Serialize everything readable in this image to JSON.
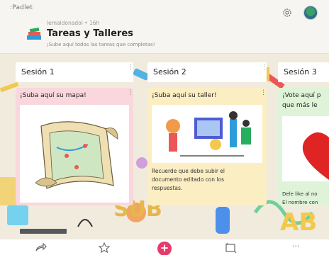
{
  "header": {
    "brand": ":Padlet",
    "meta": "lemaldonadol • 16h",
    "title": "Tareas y Talleres",
    "chevron": "›",
    "description": "¡Sube aquí todos las tareas que completas!"
  },
  "sections": [
    {
      "label": "Sesión 1"
    },
    {
      "label": "Sesión 2"
    },
    {
      "label": "Sesión 3"
    }
  ],
  "cards": [
    {
      "title": "¡Suba aquí su mapa!",
      "color": "#f9d7dc"
    },
    {
      "title": "¡Suba aquí su taller!",
      "color": "#fbeec3",
      "body": [
        "Recuerde que debe subir el",
        "documento editado con los",
        "respuestas."
      ]
    },
    {
      "title_lines": [
        "¡Vote aquí p",
        "que más le"
      ],
      "color": "#dff3d8",
      "footer": [
        "Dele like al no",
        "El nombre con"
      ]
    }
  ],
  "menu_glyph": "⋮",
  "toolbar": {
    "add_label": "+",
    "more_label": "···"
  },
  "icons": [
    "settings-icon",
    "share-icon",
    "star-icon",
    "add-icon",
    "slideshow-icon",
    "more-icon"
  ],
  "colors": {
    "accent": "#e8396b",
    "map_card": "#f9d7dc",
    "taller_card": "#fbeec3",
    "vote_card": "#dff3d8"
  }
}
